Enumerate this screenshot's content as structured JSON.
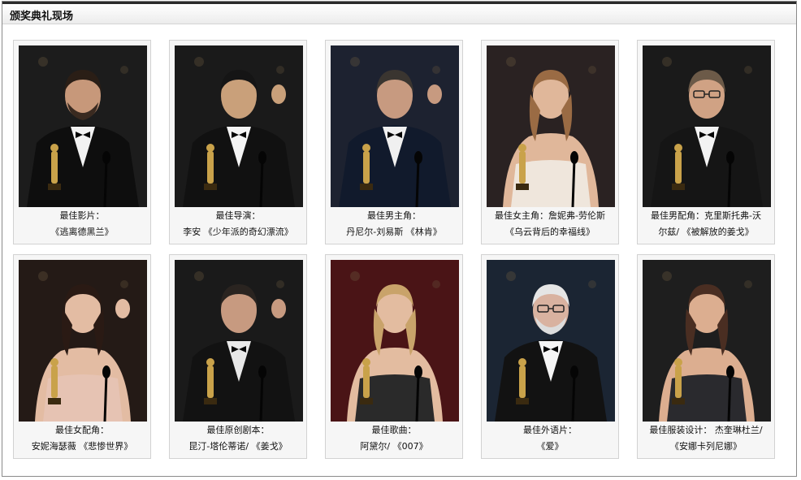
{
  "panel": {
    "title": "颁奖典礼现场"
  },
  "cards": [
    {
      "title": "最佳影片：",
      "detail": "《逃离德黑兰》",
      "photo_icon": "best-picture-winner-photo"
    },
    {
      "title": "最佳导演：",
      "detail": "李安 《少年派的奇幻漂流》",
      "photo_icon": "best-director-winner-photo"
    },
    {
      "title": "最佳男主角：",
      "detail": "丹尼尔-刘易斯 《林肯》",
      "photo_icon": "best-actor-winner-photo"
    },
    {
      "title": "最佳女主角：詹妮弗-劳伦斯",
      "detail": "《乌云背后的幸福线》",
      "photo_icon": "best-actress-winner-photo"
    },
    {
      "title": "最佳男配角：克里斯托弗-沃",
      "detail": "尔兹/ 《被解放的姜戈》",
      "photo_icon": "best-supporting-actor-winner-photo"
    },
    {
      "title": "最佳女配角：",
      "detail": "安妮海瑟薇 《悲惨世界》",
      "photo_icon": "best-supporting-actress-winner-photo"
    },
    {
      "title": "最佳原创剧本：",
      "detail": "昆汀-塔伦蒂诺/ 《姜戈》",
      "photo_icon": "best-original-screenplay-winner-photo"
    },
    {
      "title": "最佳歌曲：",
      "detail": "阿黛尔/ 《007》",
      "photo_icon": "best-song-winner-photo"
    },
    {
      "title": "最佳外语片：",
      "detail": "《爱》",
      "photo_icon": "best-foreign-film-winner-photo"
    },
    {
      "title": "最佳服装设计：  杰奎琳杜兰/",
      "detail": "《安娜卡列尼娜》",
      "photo_icon": "best-costume-design-winner-photo"
    }
  ],
  "colors": {
    "header_bar": "#2b2b2b",
    "card_border": "#d2d2d2",
    "card_bg": "#f6f6f6",
    "oscar_gold": "#c9a24a"
  }
}
